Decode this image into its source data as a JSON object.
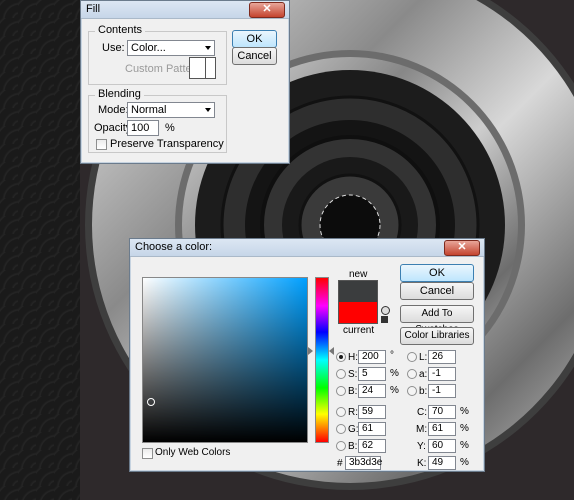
{
  "fill_dialog": {
    "title": "Fill",
    "close_glyph": "✕",
    "contents_label": "Contents",
    "use_label": "Use:",
    "use_value": "Color...",
    "custom_pattern_label": "Custom Pattern:",
    "ok_label": "OK",
    "cancel_label": "Cancel",
    "blending_label": "Blending",
    "mode_label": "Mode:",
    "mode_value": "Normal",
    "opacity_label": "Opacity:",
    "opacity_value": "100",
    "opacity_unit": "%",
    "preserve_transparency_label": "Preserve Transparency"
  },
  "color_picker": {
    "title": "Choose a color:",
    "close_glyph": "✕",
    "new_label": "new",
    "current_label": "current",
    "new_color": "#3b3d3e",
    "current_color": "#ff0000",
    "hue_color": "#00a0ff",
    "ok_label": "OK",
    "cancel_label": "Cancel",
    "add_swatches_label": "Add To Swatches",
    "color_libraries_label": "Color Libraries",
    "only_web_colors_label": "Only Web Colors",
    "fields": {
      "H": {
        "label": "H:",
        "value": "200",
        "unit": "°"
      },
      "S": {
        "label": "S:",
        "value": "5",
        "unit": "%"
      },
      "B": {
        "label": "B:",
        "value": "24",
        "unit": "%"
      },
      "R": {
        "label": "R:",
        "value": "59"
      },
      "G": {
        "label": "G:",
        "value": "61"
      },
      "Bl": {
        "label": "B:",
        "value": "62"
      },
      "L": {
        "label": "L:",
        "value": "26"
      },
      "a": {
        "label": "a:",
        "value": "-1"
      },
      "b": {
        "label": "b:",
        "value": "-1"
      },
      "C": {
        "label": "C:",
        "value": "70",
        "unit": "%"
      },
      "M": {
        "label": "M:",
        "value": "61",
        "unit": "%"
      },
      "Y": {
        "label": "Y:",
        "value": "60",
        "unit": "%"
      },
      "K": {
        "label": "K:",
        "value": "49",
        "unit": "%"
      }
    },
    "hex_label": "#",
    "hex_value": "3b3d3e"
  }
}
